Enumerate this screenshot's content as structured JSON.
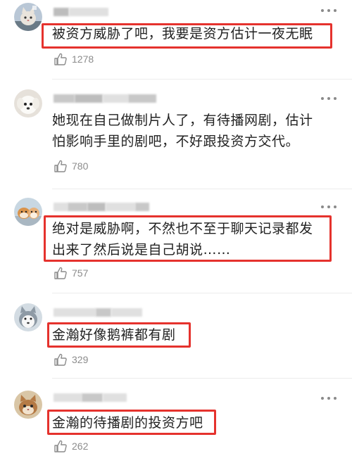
{
  "comments": [
    {
      "text_lines": [
        "被资方威胁了吧，我要是资方估计一夜无眠"
      ],
      "likes": "1278"
    },
    {
      "text_lines": [
        "她现在自己做制片人了，有待播网剧，估计",
        "怕影响手里的剧吧，不好跟投资方交代。"
      ],
      "likes": "780"
    },
    {
      "text_lines": [
        "绝对是威胁啊，不然也不至于聊天记录都发",
        "出来了然后说是自己胡说……"
      ],
      "likes": "757"
    },
    {
      "text_lines": [
        "金瀚好像鹅裤都有剧"
      ],
      "likes": "329"
    },
    {
      "text_lines": [
        "金瀚的待播剧的投资方吧"
      ],
      "likes": "262"
    }
  ],
  "colors": {
    "highlight": "#e5322d",
    "text": "#222222",
    "meta": "#8c8c8c"
  },
  "icons": {
    "like": "thumbs-up-icon",
    "more": "more-dots-icon"
  }
}
